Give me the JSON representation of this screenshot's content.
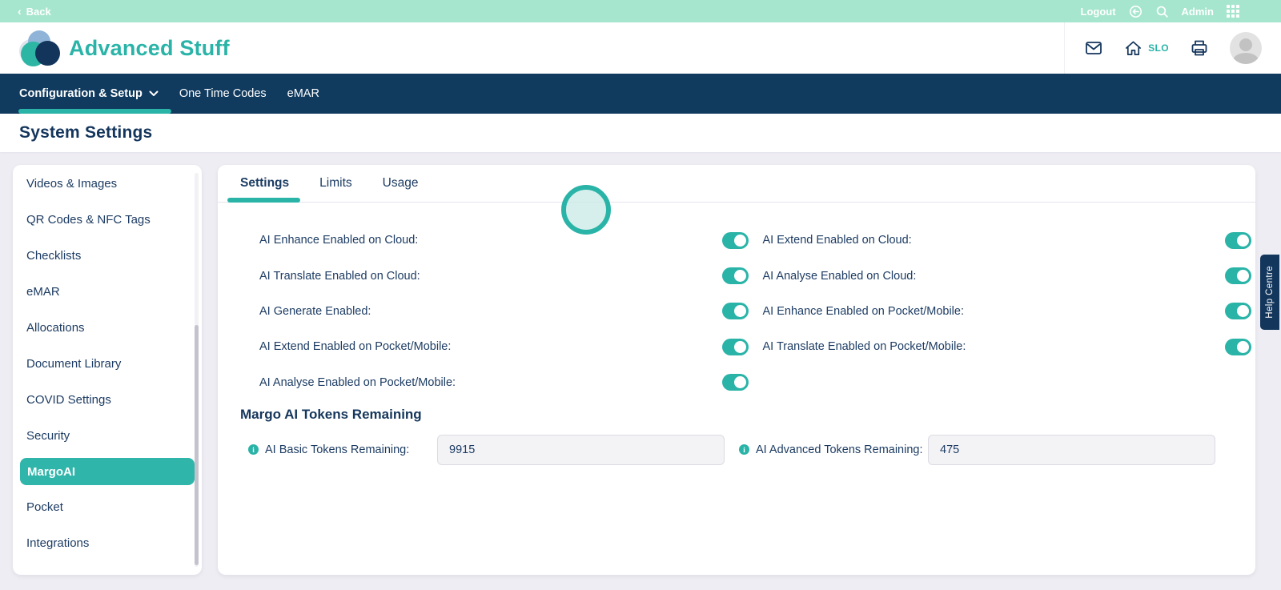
{
  "topbar": {
    "back_label": "Back",
    "logout_label": "Logout",
    "admin_label": "Admin"
  },
  "header": {
    "brand": "Advanced Stuff",
    "slo_label": "SLO"
  },
  "nav": {
    "items": [
      {
        "label": "Configuration & Setup",
        "active": true,
        "has_dropdown": true
      },
      {
        "label": "One Time Codes",
        "active": false
      },
      {
        "label": "eMAR",
        "active": false
      }
    ]
  },
  "page": {
    "title": "System Settings"
  },
  "sidebar": {
    "items": [
      {
        "label": "Videos & Images"
      },
      {
        "label": "QR Codes & NFC Tags"
      },
      {
        "label": "Checklists"
      },
      {
        "label": "eMAR"
      },
      {
        "label": "Allocations"
      },
      {
        "label": "Document Library"
      },
      {
        "label": "COVID Settings"
      },
      {
        "label": "Security"
      },
      {
        "label": "MargoAI",
        "active": true
      },
      {
        "label": "Pocket"
      },
      {
        "label": "Integrations"
      }
    ]
  },
  "tabs": [
    {
      "label": "Settings",
      "active": true
    },
    {
      "label": "Limits",
      "active": false
    },
    {
      "label": "Usage",
      "active": false
    }
  ],
  "toggles": [
    {
      "label": "AI Enhance Enabled on Cloud:",
      "on": true
    },
    {
      "label": "AI Extend Enabled on Cloud:",
      "on": true
    },
    {
      "label": "AI Translate Enabled on Cloud:",
      "on": true
    },
    {
      "label": "AI Analyse Enabled on Cloud:",
      "on": true
    },
    {
      "label": "AI Generate Enabled:",
      "on": true
    },
    {
      "label": "AI Enhance Enabled on Pocket/Mobile:",
      "on": true
    },
    {
      "label": "AI Extend Enabled on Pocket/Mobile:",
      "on": true
    },
    {
      "label": "AI Translate Enabled on Pocket/Mobile:",
      "on": true
    },
    {
      "label": "AI Analyse Enabled on Pocket/Mobile:",
      "on": true
    }
  ],
  "tokens": {
    "heading": "Margo AI Tokens Remaining",
    "fields": [
      {
        "label": "AI Basic Tokens Remaining:",
        "value": "9915"
      },
      {
        "label": "AI Advanced Tokens Remaining:",
        "value": "475"
      }
    ]
  },
  "help": {
    "label": "Help Centre"
  },
  "colors": {
    "teal": "#2ab4a8",
    "navy": "#103a5e",
    "mint": "#a6e6ce",
    "text_navy": "#1d3c63",
    "bg": "#eeedf3"
  },
  "icons": [
    "back-chevron-icon",
    "logout-icon",
    "search-icon",
    "apps-grid-icon",
    "mail-icon",
    "home-icon",
    "print-icon",
    "avatar",
    "chevron-down-icon",
    "info-icon",
    "spinner-circle"
  ]
}
